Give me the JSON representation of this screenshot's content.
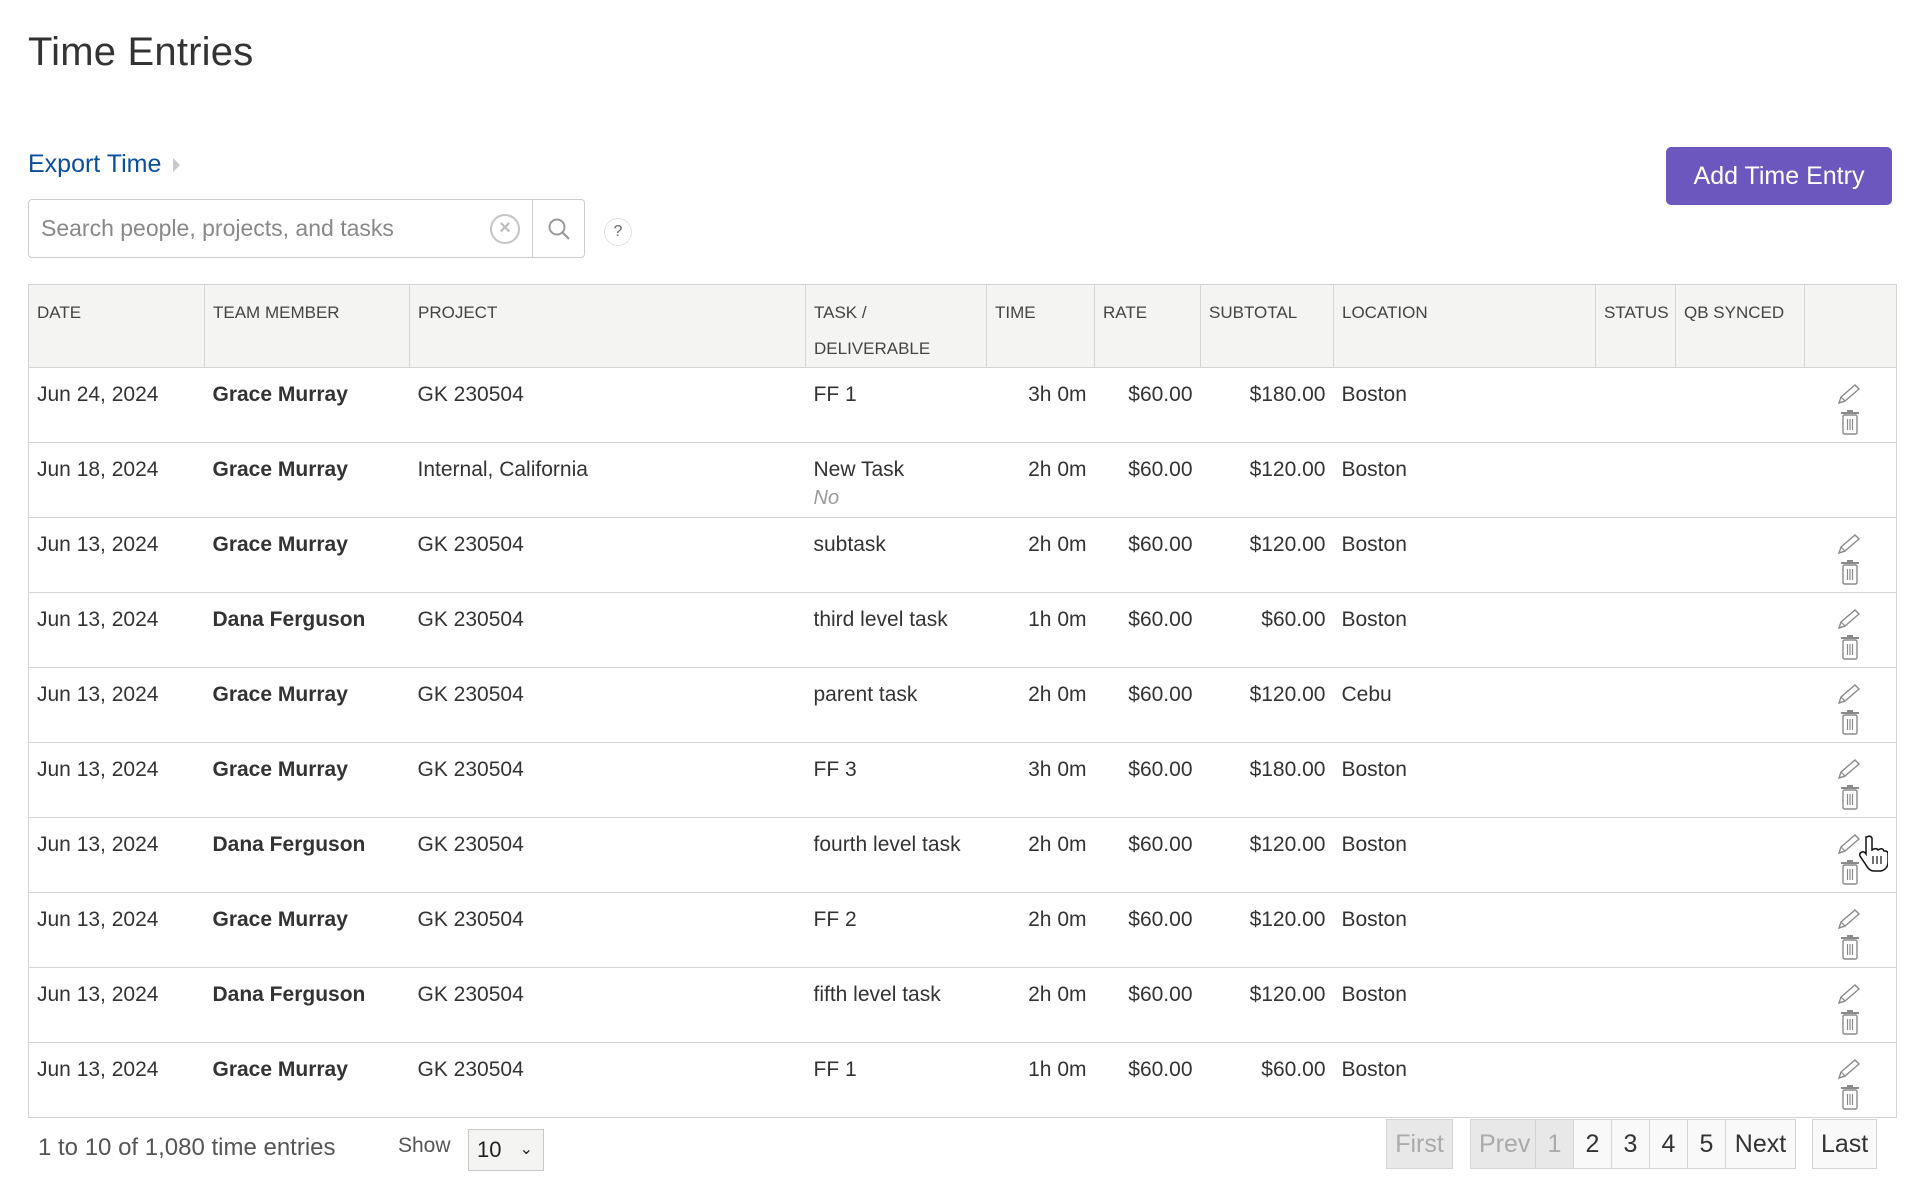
{
  "page": {
    "title": "Time Entries",
    "export_link": "Export Time",
    "add_button": "Add Time Entry",
    "accent_color": "#6c57be",
    "link_color": "#0b4f9c"
  },
  "search": {
    "placeholder": "Search people, projects, and tasks",
    "value": "",
    "clear_icon": "clear-circle-icon",
    "search_icon": "magnifier-icon",
    "help_label": "?"
  },
  "table": {
    "headers": [
      "DATE",
      "TEAM MEMBER",
      "PROJECT",
      "TASK / DELIVERABLE",
      "TIME",
      "RATE",
      "SUBTOTAL",
      "LOCATION",
      "STATUS",
      "QB SYNCED",
      ""
    ],
    "rows": [
      {
        "date": "Jun 24, 2024",
        "member": "Grace Murray",
        "project": "GK 230504",
        "task": "FF 1",
        "task_note": "",
        "time": "3h 0m",
        "rate": "$60.00",
        "subtotal": "$180.00",
        "location": "Boston",
        "status": "",
        "qb_synced": "",
        "editable": true
      },
      {
        "date": "Jun 18, 2024",
        "member": "Grace Murray",
        "project": "Internal, California",
        "task": "New Task",
        "task_note": "No",
        "time": "2h 0m",
        "rate": "$60.00",
        "subtotal": "$120.00",
        "location": "Boston",
        "status": "",
        "qb_synced": "",
        "editable": false
      },
      {
        "date": "Jun 13, 2024",
        "member": "Grace Murray",
        "project": "GK 230504",
        "task": "subtask",
        "task_note": "",
        "time": "2h 0m",
        "rate": "$60.00",
        "subtotal": "$120.00",
        "location": "Boston",
        "status": "",
        "qb_synced": "",
        "editable": true
      },
      {
        "date": "Jun 13, 2024",
        "member": "Dana Ferguson",
        "project": "GK 230504",
        "task": "third level task",
        "task_note": "",
        "time": "1h 0m",
        "rate": "$60.00",
        "subtotal": "$60.00",
        "location": "Boston",
        "status": "",
        "qb_synced": "",
        "editable": true
      },
      {
        "date": "Jun 13, 2024",
        "member": "Grace Murray",
        "project": "GK 230504",
        "task": "parent task",
        "task_note": "",
        "time": "2h 0m",
        "rate": "$60.00",
        "subtotal": "$120.00",
        "location": "Cebu",
        "status": "",
        "qb_synced": "",
        "editable": true
      },
      {
        "date": "Jun 13, 2024",
        "member": "Grace Murray",
        "project": "GK 230504",
        "task": "FF 3",
        "task_note": "",
        "time": "3h 0m",
        "rate": "$60.00",
        "subtotal": "$180.00",
        "location": "Boston",
        "status": "",
        "qb_synced": "",
        "editable": true
      },
      {
        "date": "Jun 13, 2024",
        "member": "Dana Ferguson",
        "project": "GK 230504",
        "task": "fourth level task",
        "task_note": "",
        "time": "2h 0m",
        "rate": "$60.00",
        "subtotal": "$120.00",
        "location": "Boston",
        "status": "",
        "qb_synced": "",
        "editable": true
      },
      {
        "date": "Jun 13, 2024",
        "member": "Grace Murray",
        "project": "GK 230504",
        "task": "FF 2",
        "task_note": "",
        "time": "2h 0m",
        "rate": "$60.00",
        "subtotal": "$120.00",
        "location": "Boston",
        "status": "",
        "qb_synced": "",
        "editable": true
      },
      {
        "date": "Jun 13, 2024",
        "member": "Dana Ferguson",
        "project": "GK 230504",
        "task": "fifth level task",
        "task_note": "",
        "time": "2h 0m",
        "rate": "$60.00",
        "subtotal": "$120.00",
        "location": "Boston",
        "status": "",
        "qb_synced": "",
        "editable": true
      },
      {
        "date": "Jun 13, 2024",
        "member": "Grace Murray",
        "project": "GK 230504",
        "task": "FF 1",
        "task_note": "",
        "time": "1h 0m",
        "rate": "$60.00",
        "subtotal": "$60.00",
        "location": "Boston",
        "status": "",
        "qb_synced": "",
        "editable": true
      }
    ]
  },
  "footer": {
    "count_text": "1 to 10 of 1,080 time entries",
    "show_label": "Show",
    "show_value": "10",
    "pagination": {
      "first": "First",
      "prev": "Prev",
      "pages": [
        "1",
        "2",
        "3",
        "4",
        "5"
      ],
      "current_page": "1",
      "next": "Next",
      "last": "Last"
    }
  }
}
